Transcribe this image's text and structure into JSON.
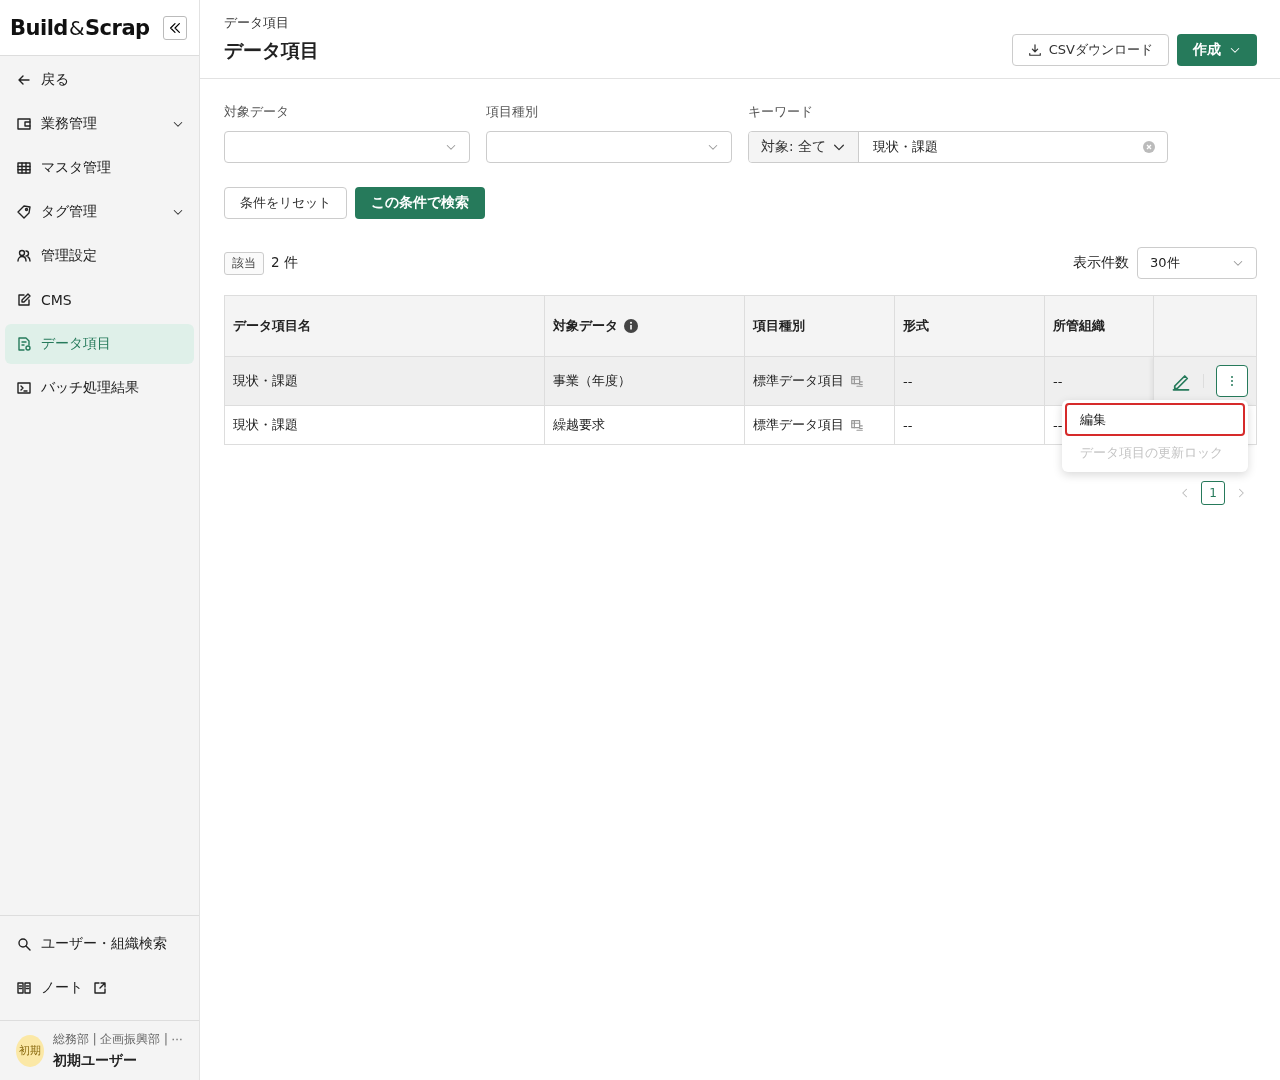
{
  "sidebar": {
    "logo": {
      "left": "Build",
      "mark": "&",
      "right": "Scrap"
    },
    "nav": [
      {
        "kind": "back",
        "label": "戻る",
        "selected": false
      },
      {
        "kind": "wallet",
        "label": "業務管理",
        "expandable": true,
        "selected": false
      },
      {
        "kind": "grid",
        "label": "マスタ管理",
        "expandable": false,
        "selected": false
      },
      {
        "kind": "tag",
        "label": "タグ管理",
        "expandable": true,
        "selected": false
      },
      {
        "kind": "users",
        "label": "管理設定",
        "expandable": false,
        "selected": false
      },
      {
        "kind": "edit",
        "label": "CMS",
        "expandable": false,
        "selected": false
      },
      {
        "kind": "doc",
        "label": "データ項目",
        "expandable": false,
        "selected": true
      },
      {
        "kind": "terminal",
        "label": "バッチ処理結果",
        "expandable": false,
        "selected": false
      }
    ],
    "footer_links": [
      {
        "kind": "search",
        "label": "ユーザー・組織検索",
        "external": false
      },
      {
        "kind": "book",
        "label": "ノート",
        "external": true
      }
    ],
    "user": {
      "avatar": "初期",
      "orgs": "総務部 | 企画振興部 | ⋯",
      "name": "初期ユーザー"
    }
  },
  "header": {
    "breadcrumb": "データ項目",
    "title": "データ項目",
    "csv_button": "CSVダウンロード",
    "create_button": "作成"
  },
  "filters": [
    {
      "label": "対象データ",
      "kind": "select"
    },
    {
      "label": "項目種別",
      "kind": "select"
    },
    {
      "label": "キーワード",
      "kind": "keyword",
      "scope": "対象: 全て",
      "value": "現状・課題"
    }
  ],
  "actions": {
    "reset": "条件をリセット",
    "search": "この条件で検索"
  },
  "results": {
    "badge": "該当",
    "count": "2 件",
    "per_page_label": "表示件数",
    "per_page": "30件"
  },
  "table": {
    "columns": [
      {
        "label": "データ項目名",
        "info": false
      },
      {
        "label": "対象データ",
        "info": true
      },
      {
        "label": "項目種別",
        "info": false
      },
      {
        "label": "形式",
        "info": false
      },
      {
        "label": "所管組織",
        "info": false
      }
    ],
    "rows": [
      {
        "cells": [
          "現状・課題",
          "事業（年度）",
          "標準データ項目",
          "--",
          "--"
        ],
        "hovered": true
      },
      {
        "cells": [
          "現状・課題",
          "繰越要求",
          "標準データ項目",
          "--",
          "--"
        ],
        "hovered": false
      }
    ]
  },
  "menu": [
    {
      "label": "編集",
      "focused": true,
      "disabled": false
    },
    {
      "label": "データ項目の更新ロック",
      "focused": false,
      "disabled": true
    }
  ],
  "pagination": [
    {
      "label": "1",
      "selected": true
    }
  ]
}
